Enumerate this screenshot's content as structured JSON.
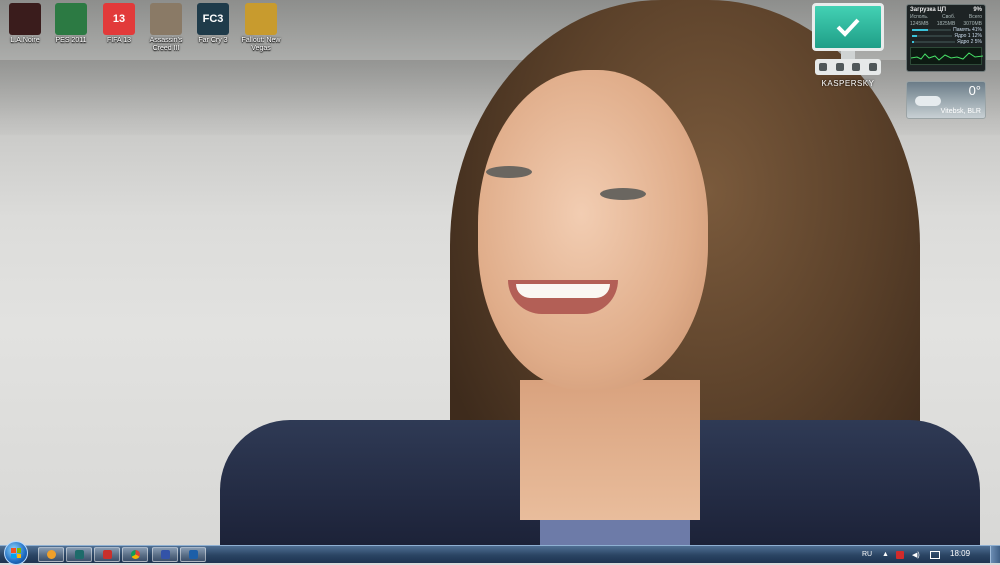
{
  "desktop_icons": [
    {
      "label": "L.A.Noire",
      "icon": "la-noire-icon",
      "color": "#3a1c1c",
      "glyph": ""
    },
    {
      "label": "PES 2011",
      "icon": "pes-2011-icon",
      "color": "#2c7a43",
      "glyph": ""
    },
    {
      "label": "FIFA 13",
      "icon": "fifa-13-icon",
      "color": "#e23a3a",
      "glyph": "13"
    },
    {
      "label": "Assassin's Creed III",
      "icon": "assassins-creed-3-icon",
      "color": "#8a7a66",
      "glyph": ""
    },
    {
      "label": "Far Cry 3",
      "icon": "far-cry-3-icon",
      "color": "#1f3b4a",
      "glyph": "FC3"
    },
    {
      "label": "Fallout: New Vegas",
      "icon": "fallout-new-vegas-icon",
      "color": "#c89b2e",
      "glyph": ""
    }
  ],
  "kaspersky": {
    "brand": "KASPERSKY",
    "status_icon": "checkmark-icon"
  },
  "cpu_gadget": {
    "title": "Загрузка ЦП",
    "total": "9%",
    "columns": [
      "Исполь.",
      "Своб.",
      "Всего"
    ],
    "values": [
      "1245MB",
      "1825MB",
      "3070MB"
    ],
    "rows": [
      {
        "label": "Память",
        "value": "41%",
        "level": 0.41
      },
      {
        "label": "Ядро 1",
        "value": "12%",
        "level": 0.12
      },
      {
        "label": "Ядро 2",
        "value": "5%",
        "level": 0.05
      }
    ]
  },
  "weather": {
    "temp": "0°",
    "city": "Vitebsk, BLR"
  },
  "taskbar": {
    "pinned": [
      {
        "name": "taskbar-aimp",
        "icon": "aimp-icon",
        "color": "#f0a02a"
      },
      {
        "name": "taskbar-audition",
        "icon": "adobe-audition-icon",
        "color": "#1e6b6b"
      },
      {
        "name": "taskbar-app3",
        "icon": "app-icon",
        "color": "#c9302c"
      },
      {
        "name": "taskbar-chrome",
        "icon": "chrome-icon",
        "color": "#4caf50"
      },
      {
        "name": "taskbar-save",
        "icon": "floppy-icon",
        "color": "#3353a8"
      },
      {
        "name": "taskbar-app6",
        "icon": "media-icon",
        "color": "#1d5fa8"
      }
    ],
    "language": "RU",
    "time": "18:09"
  }
}
